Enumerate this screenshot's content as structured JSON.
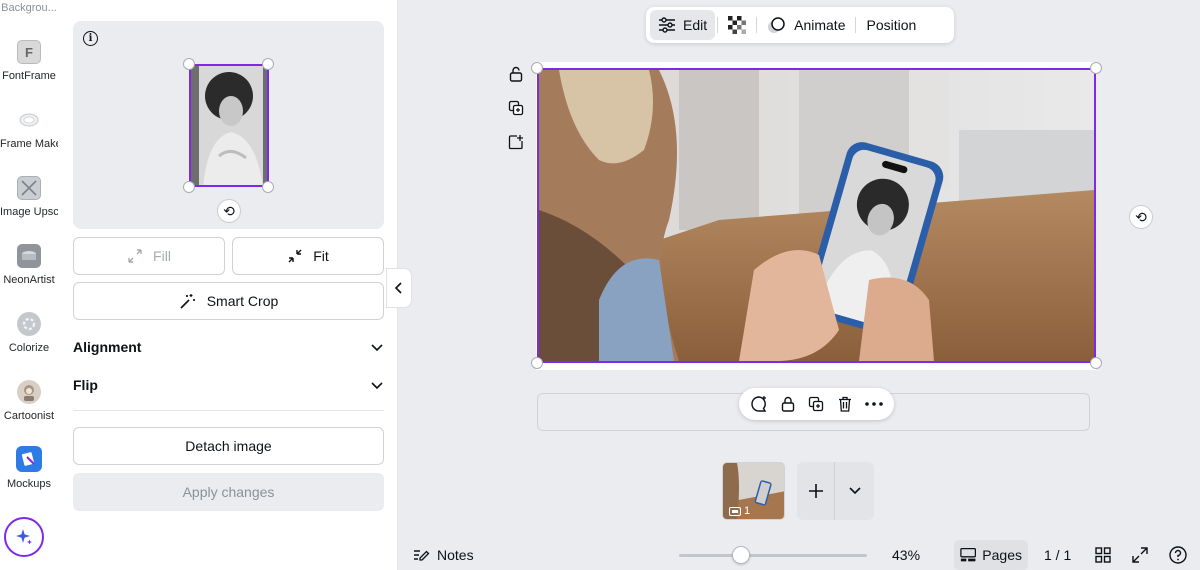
{
  "rail": {
    "top_partial": "Backgrou...",
    "items": [
      {
        "label": "FontFrame",
        "icon": "fontframe-app-icon"
      },
      {
        "label": "Frame Maker",
        "icon": "frame-maker-app-icon"
      },
      {
        "label": "Image Upsc...",
        "icon": "image-upscaler-app-icon"
      },
      {
        "label": "NeonArtist",
        "icon": "neonartist-app-icon"
      },
      {
        "label": "Colorize",
        "icon": "colorize-app-icon"
      },
      {
        "label": "Cartoonist",
        "icon": "cartoonist-app-icon"
      },
      {
        "label": "Mockups",
        "icon": "mockups-app-icon"
      }
    ]
  },
  "panel": {
    "fill_label": "Fill",
    "fit_label": "Fit",
    "smart_crop_label": "Smart Crop",
    "alignment_label": "Alignment",
    "flip_label": "Flip",
    "detach_label": "Detach image",
    "apply_label": "Apply changes"
  },
  "toolbar": {
    "edit_label": "Edit",
    "animate_label": "Animate",
    "position_label": "Position"
  },
  "pages": {
    "current_thumb_label": "1",
    "count_label": "1 / 1"
  },
  "footer": {
    "notes_label": "Notes",
    "zoom_label": "43%",
    "zoom_fraction": 0.33,
    "pages_label": "Pages"
  },
  "colors": {
    "accent": "#7d2ae8",
    "canvas_bg": "#ebecf0"
  }
}
